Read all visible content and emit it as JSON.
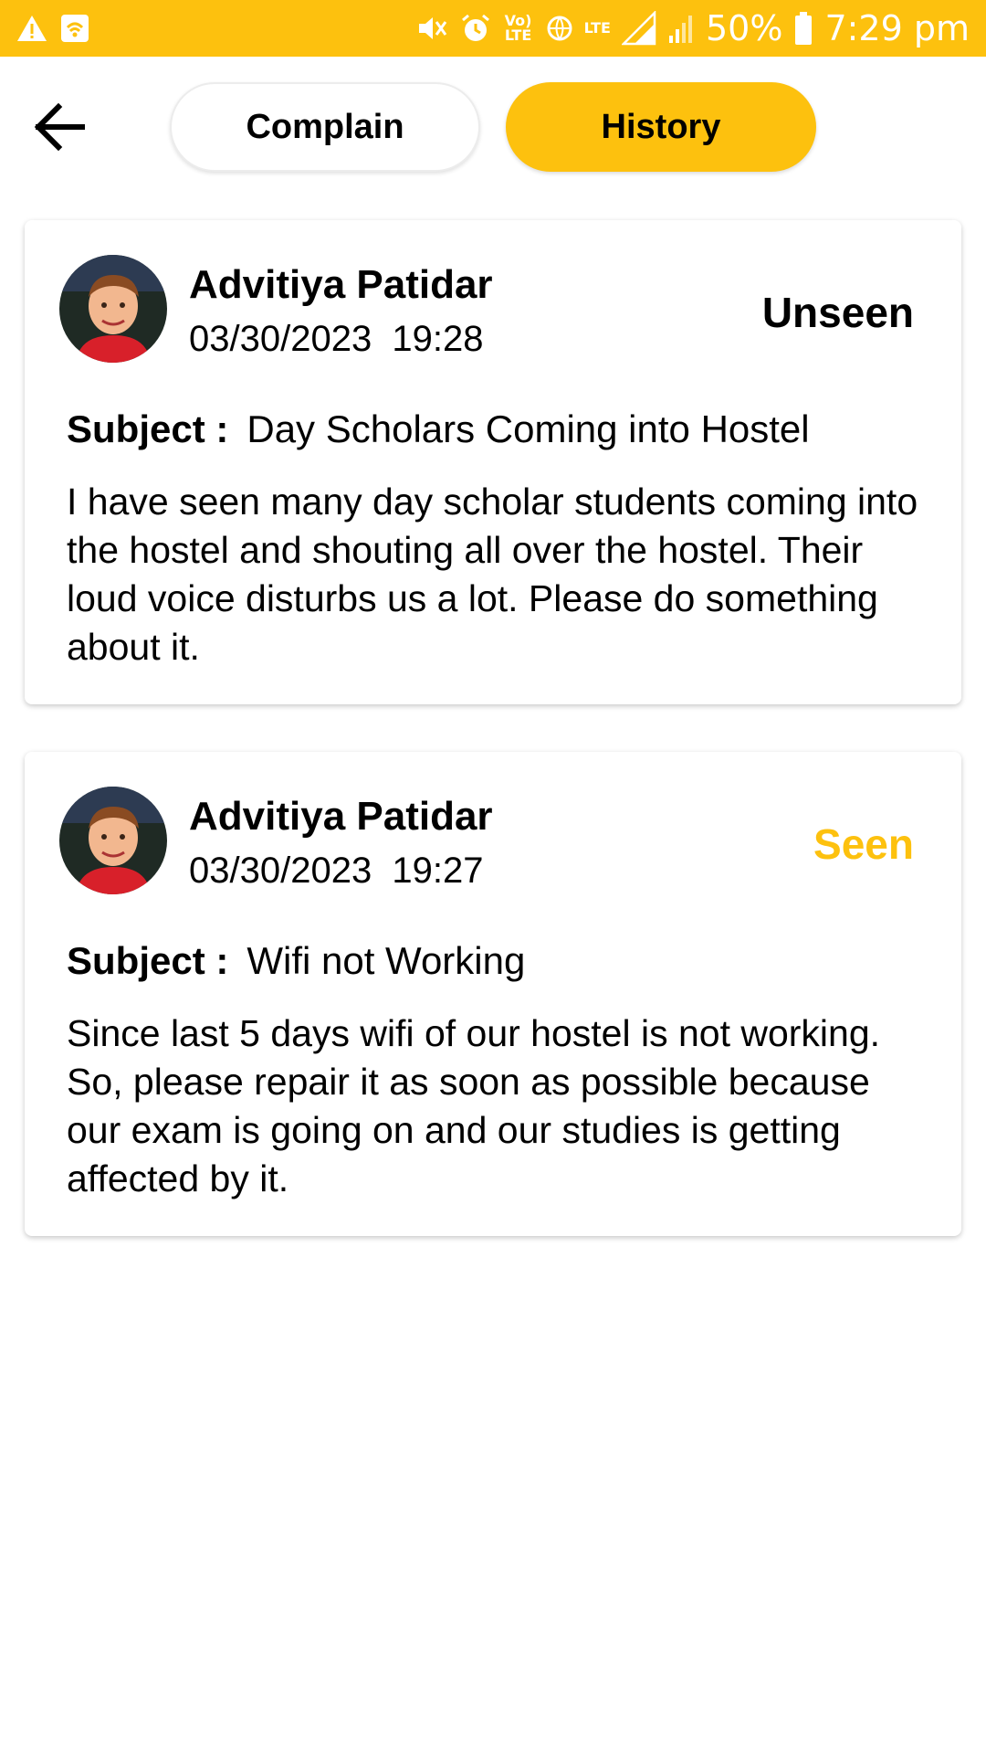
{
  "status_bar": {
    "battery": "50%",
    "time": "7:29 pm",
    "volte_label": "Vo)\nLTE",
    "lte_label": "LTE",
    "background_color": "#FDC10E",
    "icons": [
      "warning-icon",
      "wifi-hotspot-icon",
      "mute-icon",
      "alarm-icon",
      "volte-icon",
      "data-saver-icon",
      "lte-icon",
      "signal-icon",
      "signal-icon",
      "battery-icon"
    ]
  },
  "header": {
    "back_icon": "arrow-left-icon",
    "tabs": [
      {
        "label": "Complain",
        "active": false
      },
      {
        "label": "History",
        "active": true
      }
    ],
    "accent_color": "#FDC10E"
  },
  "complaints": [
    {
      "name": "Advitiya Patidar",
      "datetime": "03/30/2023  19:28",
      "status": "Unseen",
      "status_color": "#000000",
      "subject_label": "Subject :",
      "subject": "Day Scholars Coming into Hostel",
      "body": "I have seen many day scholar students coming into the hostel and shouting all over the hostel. Their loud voice disturbs us a lot. Please do something about it."
    },
    {
      "name": "Advitiya Patidar",
      "datetime": "03/30/2023  19:27",
      "status": "Seen",
      "status_color": "#FDC10E",
      "subject_label": "Subject :",
      "subject": "Wifi not Working",
      "body": "Since last 5 days wifi of our hostel is not working. So, please repair it as soon as possible because our exam is going on and our studies is getting affected by it."
    }
  ]
}
